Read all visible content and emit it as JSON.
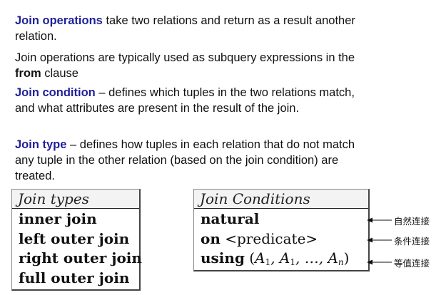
{
  "paragraphs": {
    "p1": {
      "term": "Join operations",
      "rest": " take two relations and return as a result another relation."
    },
    "p2": {
      "before": "Join operations are typically used as subquery expressions in the ",
      "bold": "from",
      "after": " clause"
    },
    "p3": {
      "term": "Join condition",
      "rest": " – defines which tuples in the two relations match, and what attributes are present in the result of the join."
    },
    "p4": {
      "term": "Join type",
      "rest": " – defines how tuples in each relation that do not match any tuple in the other relation (based on the join condition) are treated."
    }
  },
  "join_types": {
    "header": "Join types",
    "rows": [
      "inner join",
      "left outer join",
      "right outer join",
      "full outer join"
    ]
  },
  "join_conditions": {
    "header": "Join Conditions",
    "natural": "natural",
    "on_keyword": "on",
    "on_arg": " <predicate>",
    "using_keyword": "using",
    "using_open": " (",
    "a": "A",
    "sub_1": "1",
    "sub_n": "n",
    "sep": ", ",
    "ellipsis": "…",
    "close": ")"
  },
  "annotations": [
    "自然连接",
    "条件连接",
    "等值连接"
  ],
  "colors": {
    "term": "#1f1f9a",
    "header_bg": "#f3f3f3"
  }
}
